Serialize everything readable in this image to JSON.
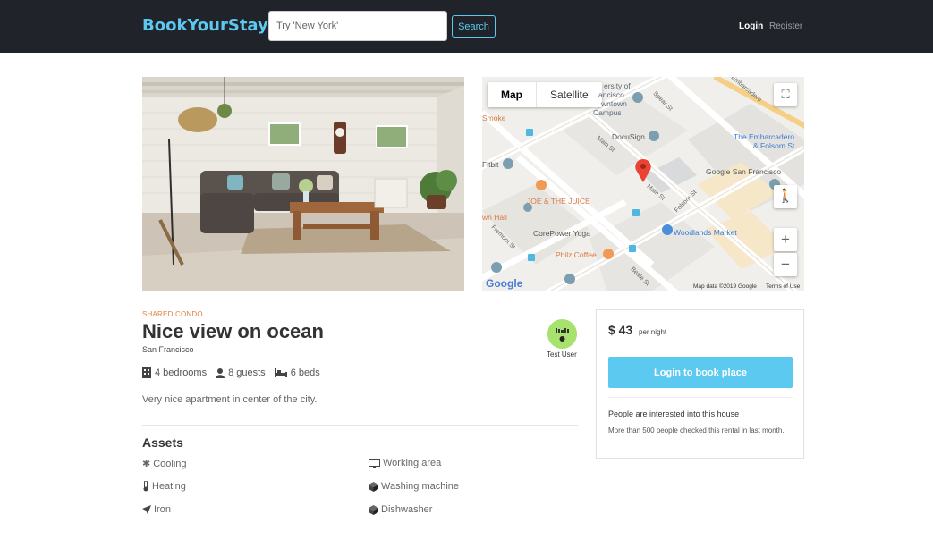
{
  "navbar": {
    "brand": "BookYourStay",
    "search_placeholder": "Try 'New York'",
    "search_button": "Search",
    "login": "Login",
    "register": "Register"
  },
  "map": {
    "type_map": "Map",
    "type_satellite": "Satellite",
    "zoom_in": "+",
    "zoom_out": "−",
    "labels": {
      "university": "ersity of",
      "francisco": "ancisco",
      "downtown": "wntown",
      "campus": "Campus",
      "smoke": "Smoke",
      "docusign": "DocuSign",
      "embarcadero": "The Embarcadero",
      "folsom": "& Folsom St",
      "fitbit": "Fitbit",
      "google_sf": "Google San Francisco",
      "joe_juice": "JOE & THE JUICE",
      "town_hall": "wn Hall",
      "corepower": "CorePower Yoga",
      "woodlands": "Woodlands Market",
      "philz": "Philz Coffee",
      "main_st": "Main St",
      "folsom_st": "Folsom St",
      "fremont_st": "Fremont St",
      "beale_st": "Beale St",
      "spear_st": "Spear St",
      "embarcadero_road": "Embarcadero"
    },
    "google_logo": "Google",
    "map_data": "Map data ©2019 Google",
    "terms": "Terms of Use"
  },
  "listing": {
    "category": "SHARED CONDO",
    "title": "Nice view on ocean",
    "city": "San Francisco",
    "bedrooms": "4 bedrooms",
    "guests": "8 guests",
    "beds": "6 beds",
    "description": "Very nice apartment in center of the city."
  },
  "host": {
    "name": "Test User"
  },
  "assets": {
    "title": "Assets",
    "items": [
      "Cooling",
      "Heating",
      "Iron",
      "Working area",
      "Washing machine",
      "Dishwasher"
    ]
  },
  "booking": {
    "price": "$ 43",
    "per_night": "per night",
    "button": "Login to book place",
    "interest_title": "People are interested into this house",
    "interest_sub": "More than 500 people checked this rental in last month."
  },
  "colors": {
    "navbar_bg": "#202329",
    "accent": "#5bc9f0",
    "category": "#e0813f"
  }
}
